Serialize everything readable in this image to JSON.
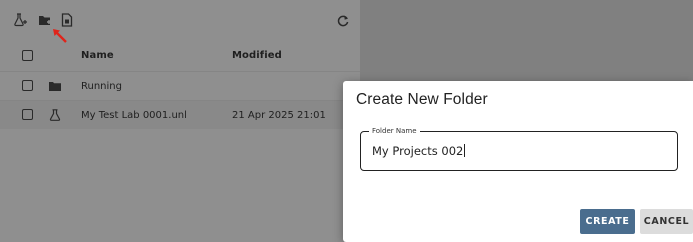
{
  "toolbar": {
    "icons": [
      "add-lab-icon",
      "add-folder-icon",
      "import-file-icon",
      "refresh-icon"
    ]
  },
  "table": {
    "columns": [
      "Name",
      "Modified"
    ],
    "rows": [
      {
        "type": "folder",
        "name": "Running",
        "modified": ""
      },
      {
        "type": "lab",
        "name": "My Test Lab 0001.unl",
        "modified": "21 Apr 2025 21:01"
      }
    ]
  },
  "dialog": {
    "title": "Create New Folder",
    "field_label": "Folder Name",
    "field_value": "My Projects 002",
    "create_label": "CREATE",
    "cancel_label": "CANCEL"
  },
  "colors": {
    "annotation_arrow": "#e0241b",
    "create_button": "#4a6d8e",
    "cancel_button": "#dcdcdc"
  }
}
